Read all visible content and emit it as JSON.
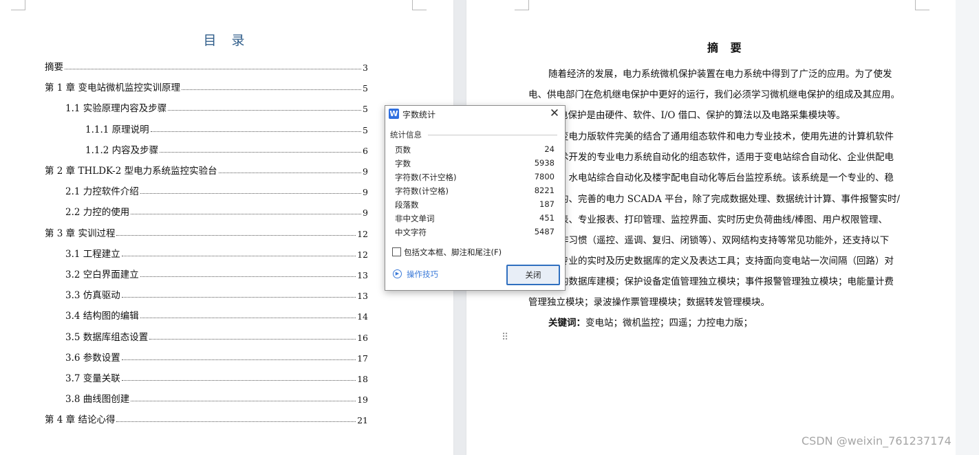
{
  "toc": {
    "title": "目 录",
    "items": [
      {
        "label": "摘要",
        "page": "3"
      },
      {
        "label": "第 1 章  变电站微机监控实训原理",
        "page": "5"
      },
      {
        "label": "1.1  实验原理内容及步骤",
        "page": "5"
      },
      {
        "label": "1.1.1  原理说明",
        "page": "5"
      },
      {
        "label": "1.1.2  内容及步骤",
        "page": "6"
      },
      {
        "label": "第 2 章  THLDK-2  型电力系统监控实验台",
        "page": "9"
      },
      {
        "label": "2.1  力控软件介绍",
        "page": "9"
      },
      {
        "label": "2.2  力控的使用",
        "page": "9"
      },
      {
        "label": "第 3 章  实训过程",
        "page": "12"
      },
      {
        "label": "3.1  工程建立",
        "page": "12"
      },
      {
        "label": "3.2  空白界面建立",
        "page": "13"
      },
      {
        "label": "3.3  仿真驱动",
        "page": "13"
      },
      {
        "label": "3.4  结构图的编辑",
        "page": "14"
      },
      {
        "label": "3.5  数据库组态设置",
        "page": "16"
      },
      {
        "label": "3.6  参数设置",
        "page": "17"
      },
      {
        "label": "3.7  变量关联",
        "page": "18"
      },
      {
        "label": "3.8  曲线图创建",
        "page": "19"
      },
      {
        "label": "第 4 章  结论心得",
        "page": "21"
      }
    ]
  },
  "abstract": {
    "title": "摘 要",
    "lines": [
      "随着经济的发展，电力系统微机保护装置在电力系统中得到了广泛的应用。为了使发",
      "电、供电部门在危机继电保护中更好的运行，我们必须学习微机继电保护的组成及其应用。",
      "电保护是由硬件、软件、I/O 借口、保护的算法以及电路采集模块等。",
      "变电力版软件完美的结合了通用组态软件和电力专业技术，使用先进的计算机软件",
      "术开发的专业电力系统自动化的组态软件，适用于变电站综合自动化、企业供配电",
      "、水电站综合自动化及楼宇配电自动化等后台监控系统。该系统是一个专业的、稳",
      "的、完善的电力 SCADA 平台，除了完成数据处理、数据统计计算、事件报警实时/",
      "表、专业报表、打印管理、监控界面、实时历史负荷曲线/棒图、用户权限管理、",
      "作习惯（遥控、遥调、复归、闭锁等）、双网结构支持等常见功能外，还支持以下",
      "专业的实时及历史数据库的定义及表达工具；支持面向变电站一次间隔（回路）对",
      "的数据库建模；保护设备定值管理独立模块；事件报警管理独立模块；电能量计费",
      "管理独立模块；录波操作票管理模块；数据转发管理模块。"
    ],
    "keywords_label": "关键词：",
    "keywords": "变电站；微机监控；四遥；力控电力版；"
  },
  "dialog": {
    "logo": "W",
    "title": "字数统计",
    "section": "统计信息",
    "stats": [
      {
        "name": "页数",
        "value": "24"
      },
      {
        "name": "字数",
        "value": "5938"
      },
      {
        "name": "字符数(不计空格)",
        "value": "7800"
      },
      {
        "name": "字符数(计空格)",
        "value": "8221"
      },
      {
        "name": "段落数",
        "value": "187"
      },
      {
        "name": "非中文单词",
        "value": "451"
      },
      {
        "name": "中文字符",
        "value": "5487"
      }
    ],
    "checkbox_label": "包括文本框、脚注和尾注(F)",
    "checkbox_checked": false,
    "tips_label": "操作技巧",
    "close_label": "关闭",
    "close_glyph": "✕"
  },
  "watermark": "CSDN @weixin_761237174"
}
